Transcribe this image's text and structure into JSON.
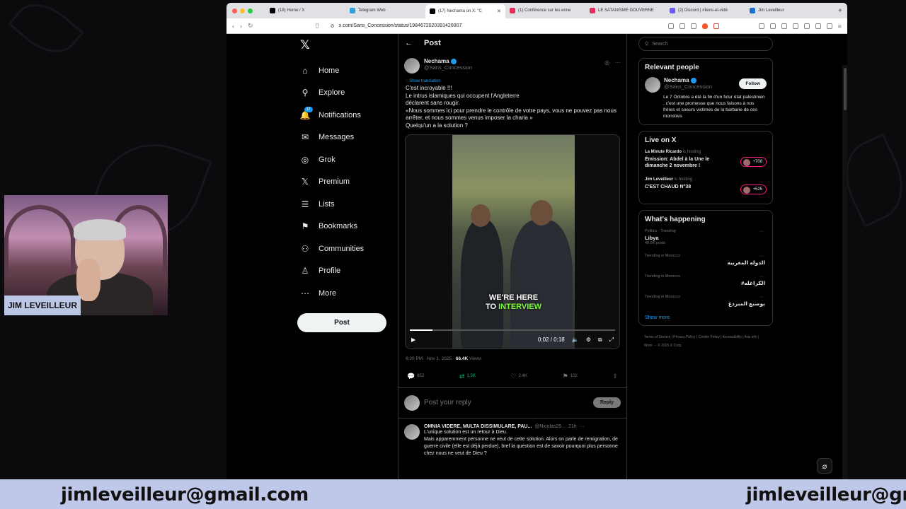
{
  "browser": {
    "tabs": [
      {
        "label": "(18) Home / X",
        "icon_color": "#000000",
        "active": false
      },
      {
        "label": "Telegram Web",
        "icon_color": "#2aa3e0",
        "active": false
      },
      {
        "label": "(17) Nechama on X: \"C",
        "icon_color": "#000000",
        "active": true
      },
      {
        "label": "(1) Conférence sur les enne",
        "icon_color": "#e02f5f",
        "active": false
      },
      {
        "label": "LE SATANISME GOUVERNE",
        "icon_color": "#e02f5f",
        "active": false
      },
      {
        "label": "(2) Discord | #liens-et-vidé",
        "icon_color": "#6a5df2",
        "active": false
      },
      {
        "label": "Jim Leveilleur",
        "icon_color": "#1f6fd1",
        "active": false
      }
    ],
    "url": "x.com/Sans_Concession/status/1984672020391420007"
  },
  "nav": {
    "items": [
      {
        "label": "Home",
        "icon": "home-icon",
        "glyph": "⌂"
      },
      {
        "label": "Explore",
        "icon": "search-icon",
        "glyph": "⚲"
      },
      {
        "label": "Notifications",
        "icon": "bell-icon",
        "glyph": "🔔"
      },
      {
        "label": "Messages",
        "icon": "mail-icon",
        "glyph": "✉"
      },
      {
        "label": "Grok",
        "icon": "grok-icon",
        "glyph": "◎"
      },
      {
        "label": "Premium",
        "icon": "x-premium-icon",
        "glyph": "𝕏"
      },
      {
        "label": "Lists",
        "icon": "list-icon",
        "glyph": "☰"
      },
      {
        "label": "Bookmarks",
        "icon": "bookmark-icon",
        "glyph": "⚑"
      },
      {
        "label": "Communities",
        "icon": "communities-icon",
        "glyph": "⚇"
      },
      {
        "label": "Profile",
        "icon": "profile-icon",
        "glyph": "♙"
      },
      {
        "label": "More",
        "icon": "more-icon",
        "glyph": "⋯"
      }
    ],
    "notif_badge": "17",
    "post_button": "Post"
  },
  "post": {
    "header": "Post",
    "author_name": "Nechama",
    "author_handle": "@Sans_Concession",
    "show_translation": "Show translation",
    "text": "C'est incroyable !!!\nLe intrus islamiques qui occupent l'Angleterre\ndéclarent sans rougir.\n«Nous sommes ici pour prendre le contrôle de votre pays, vous ne pouvez pas nous arrêter, et nous sommes venus imposer la charia »\nQuelqu'un a la solution ?",
    "caption_line1": "WE'RE HERE",
    "caption_line2a": "TO",
    "caption_line2b": "INTERVIEW",
    "video_time": "0:02 / 0:18",
    "progress": 0.11,
    "timestamp": "6:20 PM · Nov 1, 2025 ·",
    "views_count": "66.4K",
    "views_label": "Views",
    "stats": {
      "replies": "852",
      "reposts": "1.5K",
      "likes": "2.4K",
      "bookmarks": "102"
    },
    "reply_placeholder": "Post your reply",
    "reply_button": "Reply"
  },
  "reply": {
    "name": "OMNIA VIDERE, MULTA DISSIMULARE, PAU...",
    "handle": "@Nicolas25...",
    "time": "21h",
    "text": "L'unique solution est un retour à Dieu.\nMais apparemment personne ne veut de cette solution. Alors on parle de remigration, de guerre civile (elle est déjà perdue), bref la question est de savoir pourquoi plus personne chez nous ne veut de Dieu ?"
  },
  "sidebar": {
    "search_placeholder": "Search",
    "relevant_title": "Relevant people",
    "relevant": {
      "name": "Nechama",
      "handle": "@Sans_Concession",
      "follow": "Follow",
      "bio": "Le 7 Octobre a été la fin d'un futur état palestinien . c'est une promesse que nous faisons à nos frères et soeurs victimes de la barbarie de ces monstres"
    },
    "live_title": "Live on X",
    "live": [
      {
        "host": "La Minute Ricardo",
        "hosting": "is hosting",
        "title": "Émission: Abdel à la Une le dimanche 2 novembre !",
        "count": "+708"
      },
      {
        "host": "Jim Leveilleur",
        "hosting": "is hosting",
        "title": "C'EST CHAUD N°38",
        "count": "+525"
      }
    ],
    "happening_title": "What's happening",
    "trends": [
      {
        "context": "Politics · Trending",
        "name": "Libya",
        "posts": "40.5K posts",
        "rtl": false
      },
      {
        "context": "Trending in Morocco",
        "name": "الدوله المغربيه",
        "posts": "",
        "rtl": true
      },
      {
        "context": "Trending in Morocco",
        "name": "#الكراغله",
        "posts": "",
        "rtl": true
      },
      {
        "context": "Trending in Morocco",
        "name": "بوصبع المبردع",
        "posts": "",
        "rtl": true
      }
    ],
    "show_more": "Show more",
    "footer": "Terms of Service  |  Privacy Policy  |  Cookie Policy  |  Accessibility  |  Ads info  |  More ···  © 2025 X Corp."
  },
  "webcam": {
    "label": "JIM LEVEILLEUR"
  },
  "banner": {
    "email": "jimleveilleur@gmail.com",
    "email_repeat": "jimleveilleur@gm"
  }
}
